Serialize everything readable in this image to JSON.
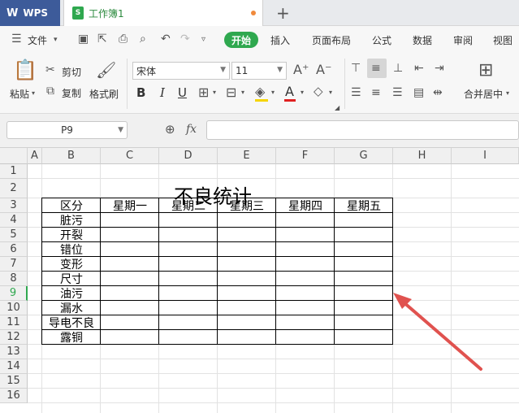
{
  "titlebar": {
    "app_label": "WPS",
    "doc_tab_label": "工作簿1",
    "new_tab_symbol": "+"
  },
  "menubar": {
    "file_label": "文件",
    "items": [
      "开始",
      "插入",
      "页面布局",
      "公式",
      "数据",
      "审阅",
      "视图"
    ]
  },
  "ribbon": {
    "paste_label": "粘贴",
    "cut_label": "剪切",
    "copy_label": "复制",
    "format_painter_label": "格式刷",
    "font_name": "宋体",
    "font_size": "11",
    "bold": "B",
    "italic": "I",
    "underline": "U",
    "merge_center_label": "合并居中"
  },
  "formula_bar": {
    "cell_ref": "P9",
    "fx_label": "fx",
    "formula_value": ""
  },
  "columns": [
    "A",
    "B",
    "C",
    "D",
    "E",
    "F",
    "G",
    "H",
    "I"
  ],
  "rows": [
    "1",
    "2",
    "3",
    "4",
    "5",
    "6",
    "7",
    "8",
    "9",
    "10",
    "11",
    "12",
    "13",
    "14",
    "15",
    "16"
  ],
  "selected_row": "9",
  "sheet": {
    "title": "不良统计",
    "header": [
      "区分",
      "星期一",
      "星期二",
      "星期三",
      "星期四",
      "星期五"
    ],
    "categories": [
      "脏污",
      "开裂",
      "错位",
      "变形",
      "尺寸",
      "油污",
      "漏水",
      "导电不良",
      "露铜"
    ]
  },
  "colors": {
    "accent_green": "#2fa84f",
    "wps_blue": "#3d5b9a",
    "arrow_red": "#e0524f"
  }
}
